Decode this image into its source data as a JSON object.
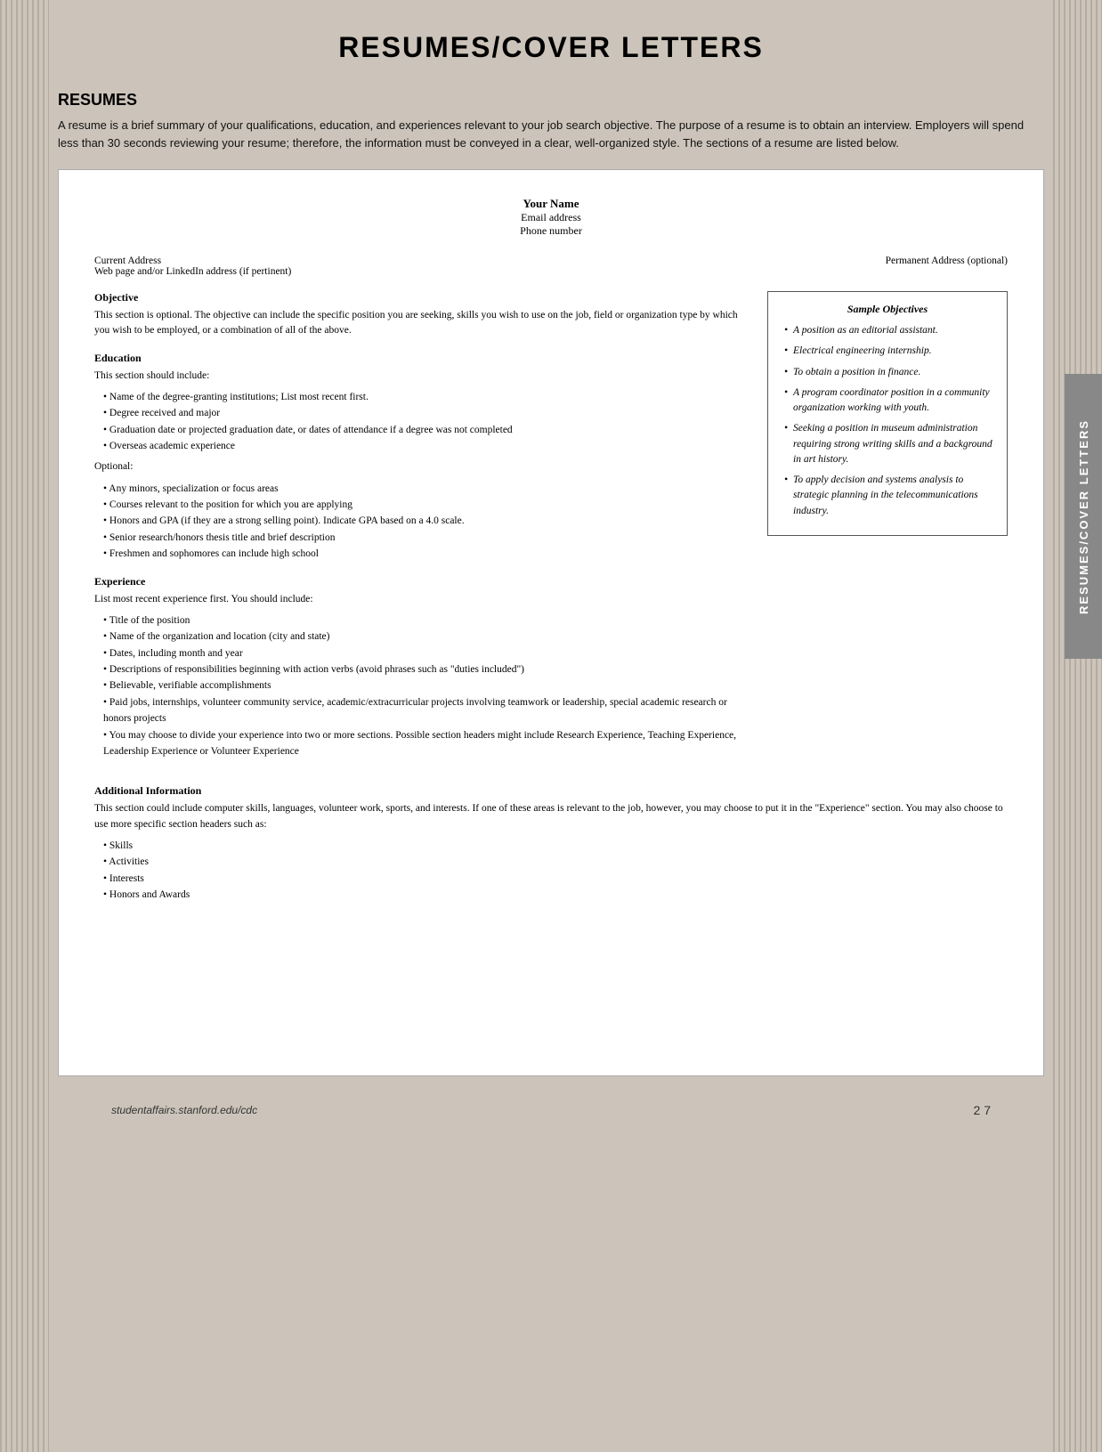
{
  "page": {
    "title": "RESUMES/COVER LETTERS",
    "background_color": "#ccc4ba"
  },
  "resumes_section": {
    "heading": "RESUMES",
    "intro": "A resume is a brief summary of your qualifications, education, and experiences relevant to your job search objective. The purpose of a resume is to obtain an interview. Employers will spend less than 30 seconds reviewing your resume; therefore, the information must be conveyed in a clear, well-organized style. The sections of a resume are listed below."
  },
  "doc": {
    "header": {
      "name": "Your Name",
      "email": "Email address",
      "phone": "Phone number"
    },
    "address_left": "Current Address",
    "address_left2": "Web page and/or LinkedIn address (if pertinent)",
    "address_right": "Permanent Address (optional)",
    "objective_title": "Objective",
    "objective_text": "This section is optional. The objective can include the specific position you are seeking, skills you wish to use on the job, field or organization type by which you wish to be employed, or a combination of all of the above.",
    "education_title": "Education",
    "education_intro": "This section should include:",
    "education_bullets": [
      "Name of the degree-granting institutions; List most recent first.",
      "Degree received and major",
      "Graduation date or projected graduation date, or dates of attendance if a degree was not completed",
      "Overseas academic experience"
    ],
    "optional_label": "Optional:",
    "optional_bullets": [
      "Any minors, specialization or focus areas",
      "Courses relevant to the position for which you are applying",
      "Honors and GPA (if they are a strong selling point). Indicate GPA based on a 4.0 scale.",
      "Senior research/honors thesis title and brief description",
      "Freshmen and sophomores can include high school"
    ],
    "experience_title": "Experience",
    "experience_intro": "List most recent experience first. You should include:",
    "experience_bullets": [
      "Title of the position",
      "Name of the organization and location (city and state)",
      "Dates, including month and year",
      "Descriptions of responsibilities beginning with action verbs (avoid phrases such as \"duties included\")",
      "Believable, verifiable accomplishments",
      "Paid jobs, internships, volunteer community service, academic/extracurricular projects involving teamwork or leadership, special academic research or honors projects",
      "You may choose to divide your experience into two or more sections. Possible section headers might include Research Experience, Teaching Experience, Leadership Experience or Volunteer Experience"
    ],
    "additional_title": "Additional Information",
    "additional_text": "This section could include computer skills, languages, volunteer work, sports, and interests. If one of these areas is relevant to the job, however, you may choose to put it in the \"Experience\" section. You may also choose to use more specific section headers such as:",
    "additional_bullets": [
      "Skills",
      "Activities",
      "Interests",
      "Honors and Awards"
    ]
  },
  "sample_objectives": {
    "title": "Sample Objectives",
    "items": [
      "A position as an editorial assistant.",
      "Electrical engineering internship.",
      "To obtain a position in finance.",
      "A program coordinator position in a community organization working with youth.",
      "Seeking a position in museum administration requiring strong writing skills and a background in art history.",
      "To apply decision and systems analysis to strategic planning in the telecommunications industry."
    ]
  },
  "side_tab": {
    "label": "RESUMES/COVER LETTERS"
  },
  "footer": {
    "url": "studentaffairs.stanford.edu/cdc",
    "page": "2  7"
  }
}
